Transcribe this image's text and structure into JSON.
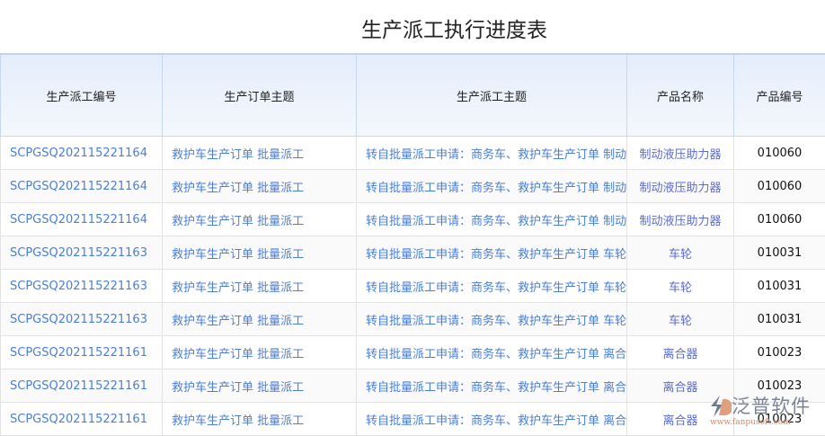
{
  "title": "生产派工执行进度表",
  "columns": [
    "生产派工编号",
    "生产订单主题",
    "生产派工主题",
    "产品名称",
    "产品编号"
  ],
  "rows": [
    [
      "SCPGSQ202115221164",
      "救护车生产订单 批量派工",
      "转自批量派工申请：商务车、救护车生产订单 制动",
      "制动液压助力器",
      "010060"
    ],
    [
      "SCPGSQ202115221164",
      "救护车生产订单 批量派工",
      "转自批量派工申请：商务车、救护车生产订单 制动",
      "制动液压助力器",
      "010060"
    ],
    [
      "SCPGSQ202115221164",
      "救护车生产订单 批量派工",
      "转自批量派工申请：商务车、救护车生产订单 制动",
      "制动液压助力器",
      "010060"
    ],
    [
      "SCPGSQ202115221163",
      "救护车生产订单 批量派工",
      "转自批量派工申请：商务车、救护车生产订单 车轮",
      "车轮",
      "010031"
    ],
    [
      "SCPGSQ202115221163",
      "救护车生产订单 批量派工",
      "转自批量派工申请：商务车、救护车生产订单 车轮",
      "车轮",
      "010031"
    ],
    [
      "SCPGSQ202115221163",
      "救护车生产订单 批量派工",
      "转自批量派工申请：商务车、救护车生产订单 车轮",
      "车轮",
      "010031"
    ],
    [
      "SCPGSQ202115221161",
      "救护车生产订单 批量派工",
      "转自批量派工申请：商务车、救护车生产订单 离合",
      "离合器",
      "010023"
    ],
    [
      "SCPGSQ202115221161",
      "救护车生产订单 批量派工",
      "转自批量派工申请：商务车、救护车生产订单 离合",
      "离合器",
      "010023"
    ],
    [
      "SCPGSQ202115221161",
      "救护车生产订单 批量派工",
      "转自批量派工申请：商务车、救护车生产订单 离合",
      "离合器",
      "010023"
    ]
  ],
  "watermark": {
    "name": "泛普软件",
    "url": "www.fanpusoft.com"
  }
}
